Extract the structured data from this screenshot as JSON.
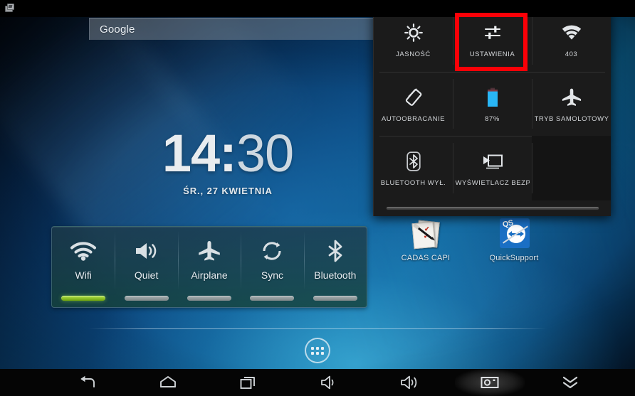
{
  "statusbar": {
    "notification_icon": "screenshot-icon"
  },
  "search": {
    "label": "Google",
    "icon": "google-search-icon"
  },
  "clock": {
    "hours": "14",
    "separator": ":",
    "minutes": "30",
    "date": "ŚR., 27 KWIETNIA"
  },
  "power_widget": {
    "toggles": [
      {
        "label": "Wifi",
        "icon": "wifi-icon",
        "state": "on"
      },
      {
        "label": "Quiet",
        "icon": "volume-icon",
        "state": "off"
      },
      {
        "label": "Airplane",
        "icon": "airplane-icon",
        "state": "off"
      },
      {
        "label": "Sync",
        "icon": "sync-icon",
        "state": "off"
      },
      {
        "label": "Bluetooth",
        "icon": "bluetooth-icon",
        "state": "off"
      }
    ],
    "active_color": "#8cd31e",
    "inactive_color": "#96a0a2"
  },
  "desktop_icons": [
    {
      "label": "CADAS CAPI",
      "icon": "cadas-capi-icon"
    },
    {
      "label": "QuickSupport",
      "icon": "quicksupport-icon"
    }
  ],
  "app_drawer": {
    "icon": "app-drawer-grid-icon"
  },
  "quick_settings": {
    "tiles": [
      {
        "label": "JASNOŚĆ",
        "icon": "brightness-sun-icon"
      },
      {
        "label": "USTAWIENIA",
        "icon": "settings-sliders-icon"
      },
      {
        "label": "403",
        "icon": "wifi-icon"
      },
      {
        "label": "AUTOOBRACANIE",
        "icon": "auto-rotate-icon"
      },
      {
        "label": "87%",
        "icon": "battery-icon"
      },
      {
        "label": "TRYB SAMOLOTOWY",
        "icon": "airplane-icon"
      },
      {
        "label": "BLUETOOTH WYŁ.",
        "icon": "bluetooth-icon"
      },
      {
        "label": "WYŚWIETLACZ BEZPRZEW",
        "icon": "cast-screen-icon"
      },
      {
        "label": "",
        "icon": ""
      }
    ],
    "highlighted_tile": "USTAWIENIA",
    "highlight_color": "#fb0007",
    "battery_color": "#29b6f6",
    "handle_icon": "panel-drag-handle"
  },
  "navbar": {
    "buttons": [
      {
        "name": "back",
        "icon": "back-arrow-icon",
        "pressed": false
      },
      {
        "name": "home",
        "icon": "home-icon",
        "pressed": false
      },
      {
        "name": "recents",
        "icon": "recent-apps-icon",
        "pressed": false
      },
      {
        "name": "volume-down",
        "icon": "volume-down-icon",
        "pressed": false
      },
      {
        "name": "volume-up",
        "icon": "volume-up-icon",
        "pressed": false
      },
      {
        "name": "screenshot",
        "icon": "camera-icon",
        "pressed": true
      },
      {
        "name": "hide-navbar",
        "icon": "double-chevron-down-icon",
        "pressed": false
      }
    ]
  }
}
